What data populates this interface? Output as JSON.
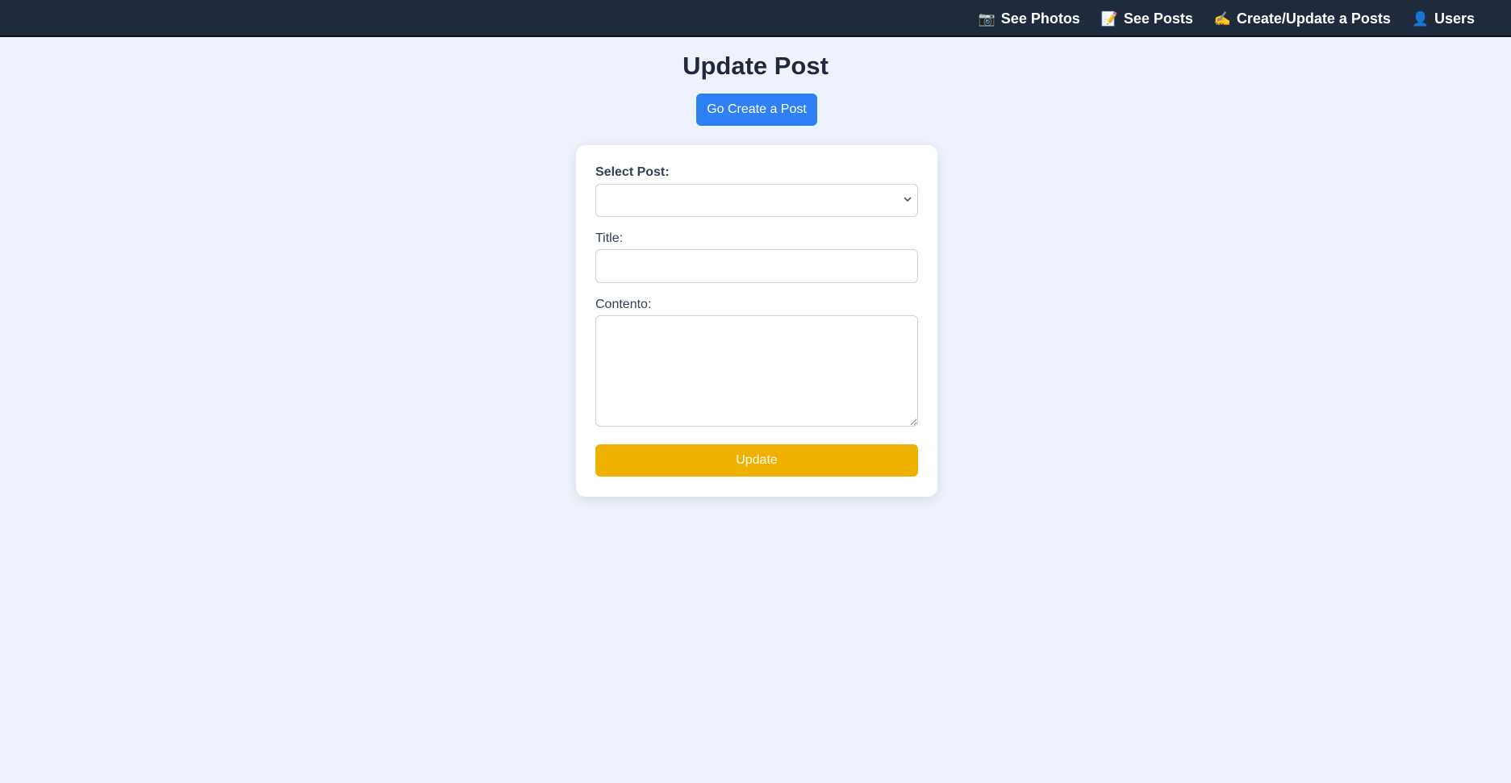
{
  "nav": {
    "items": [
      {
        "icon": "camera-icon",
        "glyph": "📷",
        "label": "See Photos"
      },
      {
        "icon": "memo-icon",
        "glyph": "📝",
        "label": "See Posts"
      },
      {
        "icon": "writing-hand-icon",
        "glyph": "✍️",
        "label": "Create/Update a Posts"
      },
      {
        "icon": "user-icon",
        "glyph": "👤",
        "label": "Users"
      }
    ]
  },
  "page": {
    "title": "Update Post",
    "create_button_label": "Go Create a Post"
  },
  "form": {
    "select_label": "Select Post:",
    "select_value": "",
    "title_label": "Title:",
    "title_value": "",
    "content_label": "Contento:",
    "content_value": "",
    "submit_label": "Update"
  },
  "colors": {
    "background": "#edf2fc",
    "topbar": "#1f2a3c",
    "primary_button": "#2f7ff5",
    "update_button": "#efb000",
    "heading": "#1e293b"
  }
}
